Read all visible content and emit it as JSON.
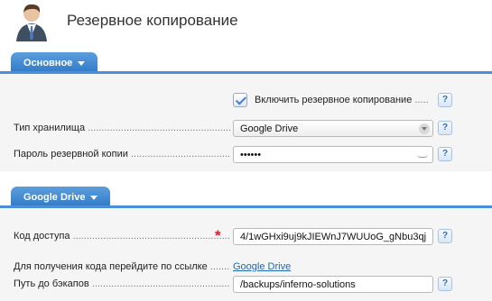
{
  "header": {
    "title": "Резервное копирование"
  },
  "sections": {
    "main": {
      "tab_label": "Основное",
      "enable_backup": {
        "label": "Включить резервное копирование",
        "checked": true
      },
      "storage_type": {
        "label": "Тип хранилища",
        "value": "Google Drive"
      },
      "backup_password": {
        "label": "Пароль резервной копии",
        "value": "••••••"
      }
    },
    "google_drive": {
      "tab_label": "Google Drive",
      "access_code": {
        "label": "Код доступа",
        "value": "4/1wGHxi9uj9kJIEWnJ7WUUoG_gNbu3qj",
        "required_mark": "*"
      },
      "code_link": {
        "label": "Для получения кода перейдите по ссылке",
        "link_text": "Google Drive"
      },
      "backup_path": {
        "label": "Путь до бэкапов",
        "value": "/backups/inferno-solutions"
      }
    }
  },
  "help_text": "?",
  "colors": {
    "accent": "#3b84d0",
    "section_bg": "#f5f5f5",
    "link": "#1f67b1",
    "required": "#d42020"
  },
  "icons": [
    "user-avatar-icon",
    "chevron-down-icon",
    "check-icon",
    "help-icon",
    "key-icon"
  ]
}
